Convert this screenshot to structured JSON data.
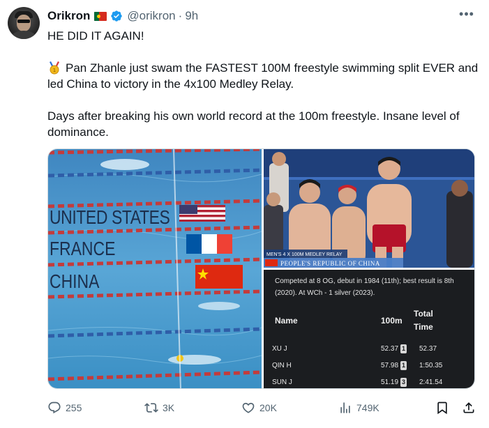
{
  "author": {
    "name": "Orikron",
    "handle": "@orikron",
    "separator": "·",
    "time": "9h"
  },
  "tweet": {
    "line1": "HE DID IT AGAIN!",
    "line2": "Pan Zhanle just swam the FASTEST 100M freestyle swimming split EVER and led China to victory in the 4x100 Medley Relay.",
    "line3": "Days after breaking his own world record at the 100m freestyle. Insane level of dominance."
  },
  "media": {
    "pool_labels": [
      "UNITED STATES",
      "FRANCE",
      "CHINA"
    ],
    "broadcast_caption": "MEN'S 4 X 100M MEDLEY RELAY",
    "broadcast_team": "PEOPLE'S REPUBLIC OF CHINA",
    "bio": "Competed at 8 OG, debut in 1984 (11th); best result is 8th (2020). At WCh - 1 silver (2023).",
    "table": {
      "col_name": "Name",
      "col_100m": "100m",
      "col_total_1": "Total",
      "col_total_2": "Time",
      "rows": [
        {
          "name": "XU J",
          "split": "52.37",
          "leg": "1",
          "total": "52.37"
        },
        {
          "name": "QIN H",
          "split": "57.98",
          "leg": "1",
          "total": "1:50.35"
        },
        {
          "name": "SUN J",
          "split": "51.19",
          "leg": "3",
          "total": "2:41.54"
        }
      ]
    }
  },
  "actions": {
    "replies": "255",
    "reposts": "3K",
    "likes": "20K",
    "views": "749K"
  },
  "colors": {
    "text": "#0f1419",
    "muted": "#536471",
    "verified": "#1d9bf0"
  }
}
